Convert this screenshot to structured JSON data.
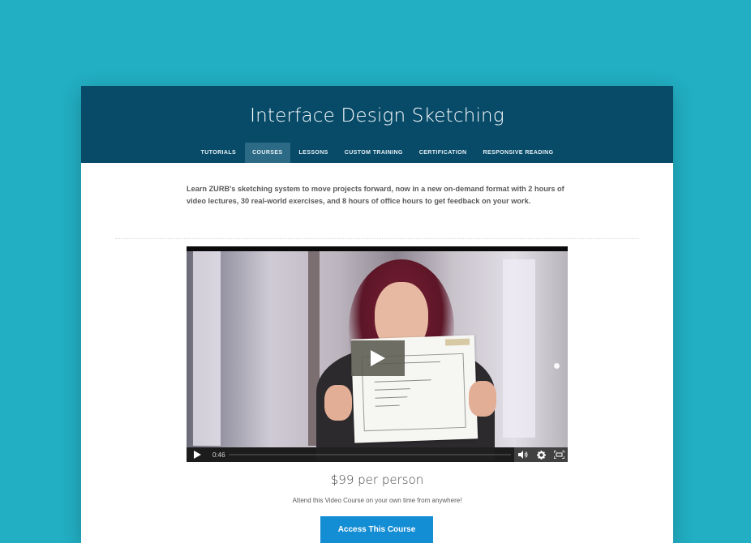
{
  "colors": {
    "page_background": "#22aec3",
    "header_background": "#074b69",
    "nav_active": "#2c6a86",
    "cta_background": "#138dd3"
  },
  "header": {
    "title": "Interface Design Sketching"
  },
  "nav": {
    "items": [
      {
        "label": "TUTORIALS",
        "active": false
      },
      {
        "label": "COURSES",
        "active": true
      },
      {
        "label": "LESSONS",
        "active": false
      },
      {
        "label": "CUSTOM TRAINING",
        "active": false
      },
      {
        "label": "CERTIFICATION",
        "active": false
      },
      {
        "label": "RESPONSIVE READING",
        "active": false
      }
    ]
  },
  "intro": {
    "text": "Learn ZURB's sketching system to move projects forward, now in a new on-demand format with 2 hours of video lectures, 30 real-world exercises, and 8 hours of office hours to get feedback on your work."
  },
  "video": {
    "time": "0:46",
    "icons": [
      "play-icon",
      "volume-icon",
      "settings-icon",
      "fullscreen-icon"
    ]
  },
  "offer": {
    "price": "$99 per person",
    "subtext": "Attend this Video Course on your own time from anywhere!",
    "cta_label": "Access This Course"
  }
}
